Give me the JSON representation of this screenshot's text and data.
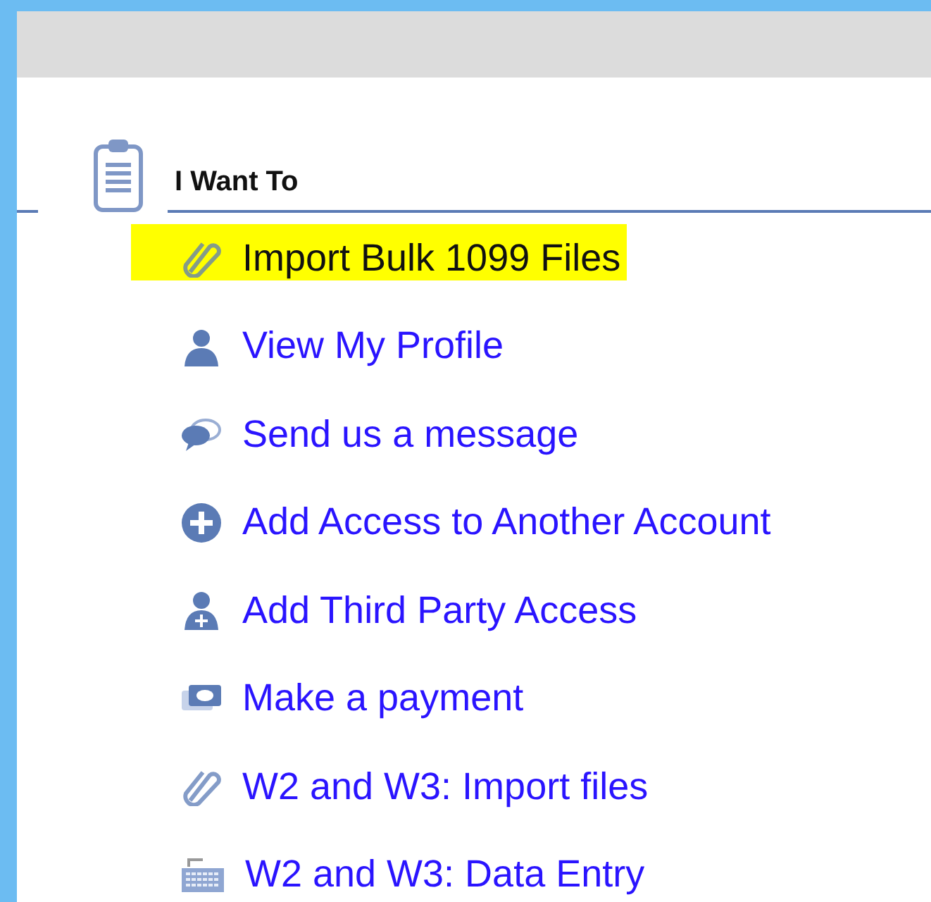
{
  "section": {
    "title": "I Want To"
  },
  "items": [
    {
      "label": "Import Bulk 1099 Files",
      "highlighted": true
    },
    {
      "label": "View My Profile",
      "highlighted": false
    },
    {
      "label": "Send us a message",
      "highlighted": false
    },
    {
      "label": "Add Access to Another Account",
      "highlighted": false
    },
    {
      "label": "Add Third Party Access",
      "highlighted": false
    },
    {
      "label": "Make a payment",
      "highlighted": false
    },
    {
      "label": "W2 and W3: Import files",
      "highlighted": false
    },
    {
      "label": "W2 and W3: Data Entry",
      "highlighted": false
    }
  ]
}
